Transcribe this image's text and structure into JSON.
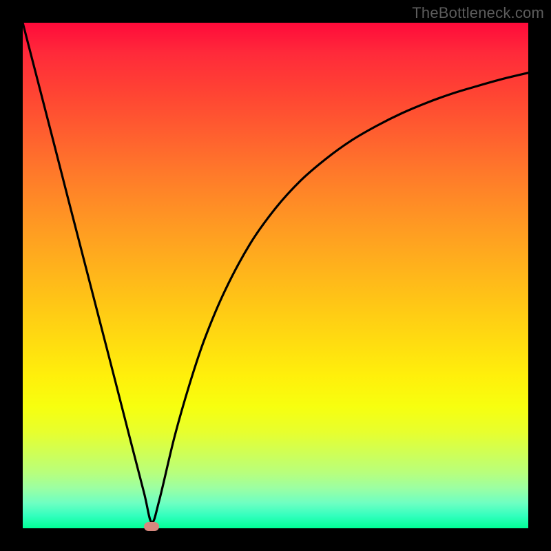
{
  "attribution": "TheBottleneck.com",
  "colors": {
    "frame": "#000000",
    "gradient_top": "#ff0a3a",
    "gradient_bottom": "#00ff96",
    "curve": "#000000",
    "marker": "#d5887e",
    "attribution_text": "#5c5c5c"
  },
  "chart_data": {
    "type": "line",
    "title": "",
    "xlabel": "",
    "ylabel": "",
    "xlim": [
      0,
      100
    ],
    "ylim": [
      0,
      100
    ],
    "grid": false,
    "legend": false,
    "background": "red-to-green vertical gradient",
    "series": [
      {
        "name": "bottleneck-curve",
        "x": [
          0,
          3,
          6,
          9,
          12,
          15,
          18,
          21,
          24,
          25.5,
          27,
          30,
          33,
          36,
          40,
          45,
          50,
          55,
          60,
          65,
          70,
          75,
          80,
          85,
          90,
          95,
          100
        ],
        "y": [
          100,
          88.4,
          76.8,
          65.1,
          53.5,
          41.9,
          30.3,
          18.6,
          7.0,
          1.2,
          5.5,
          18.0,
          28.5,
          37.5,
          47.0,
          56.3,
          63.3,
          68.8,
          73.1,
          76.7,
          79.6,
          82.1,
          84.2,
          86.0,
          87.5,
          88.9,
          90.1
        ]
      }
    ],
    "annotations": [
      {
        "name": "minimum-marker",
        "x": 25.5,
        "y": 0.4,
        "shape": "rounded-rect",
        "color": "#d5887e"
      }
    ]
  }
}
